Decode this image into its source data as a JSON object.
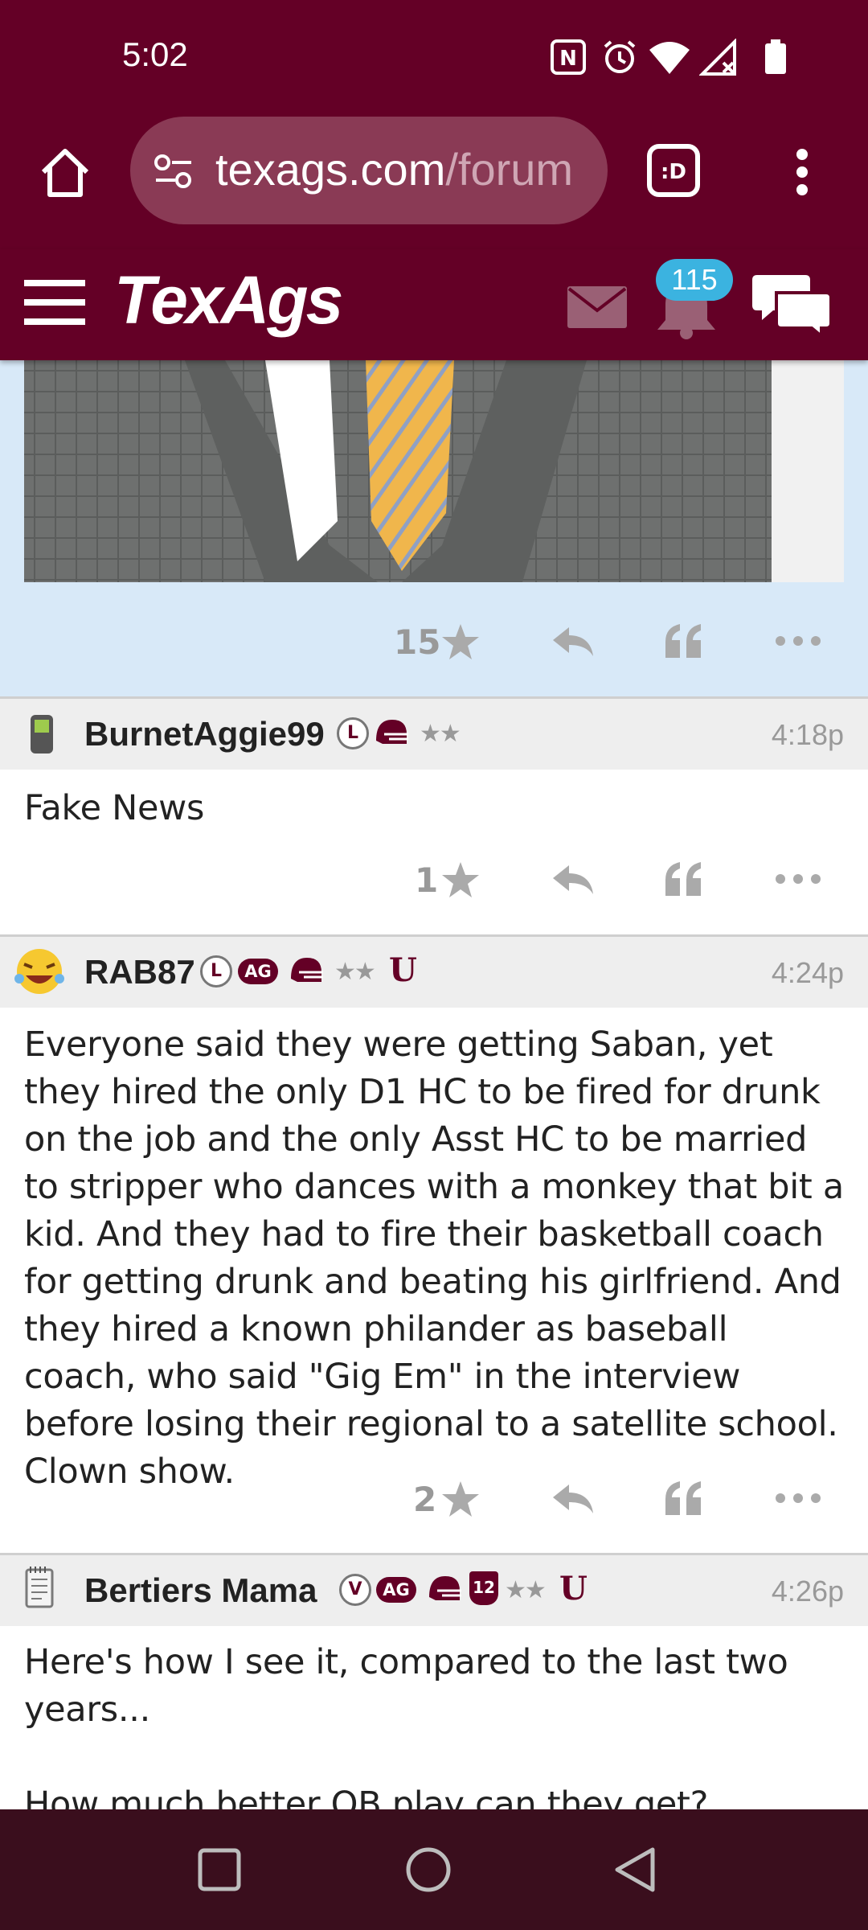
{
  "status_bar": {
    "time": "5:02"
  },
  "browser": {
    "url_main": "texags.com",
    "url_rest": "/forum"
  },
  "site_header": {
    "logo": "TexAgs",
    "notifications_count": "115"
  },
  "posts": [
    {
      "likes": "15"
    },
    {
      "username": "BurnetAggie99",
      "time": "4:18p",
      "badge_letter": "L",
      "body": "Fake News",
      "likes": "1"
    },
    {
      "username": "RAB87",
      "time": "4:24p",
      "badge_letter": "L",
      "ag_tag": "AG",
      "body": "Everyone said they were getting Saban, yet they hired the only D1 HC to be fired for drunk on the job and the only Asst HC to be married to stripper who dances with a monkey that bit a kid. And they had to fire their basketball coach for getting drunk and beating his girlfriend. And they hired a known philander as baseball coach, who said \"Gig Em\" in the interview before losing their regional to a satellite school. Clown show.",
      "likes": "2"
    },
    {
      "username": "Bertiers Mama",
      "time": "4:26p",
      "badge_letter": "V",
      "ag_tag": "AG",
      "twelve_tag": "12",
      "body_lines": [
        "Here's how I see it, compared to the last two",
        "years...",
        "",
        "How much better QB play can they get?"
      ]
    }
  ],
  "colors": {
    "maroon": "#640026",
    "post_bg_highlight": "#d8e9f8",
    "badge_blue": "#3bb3e0"
  }
}
